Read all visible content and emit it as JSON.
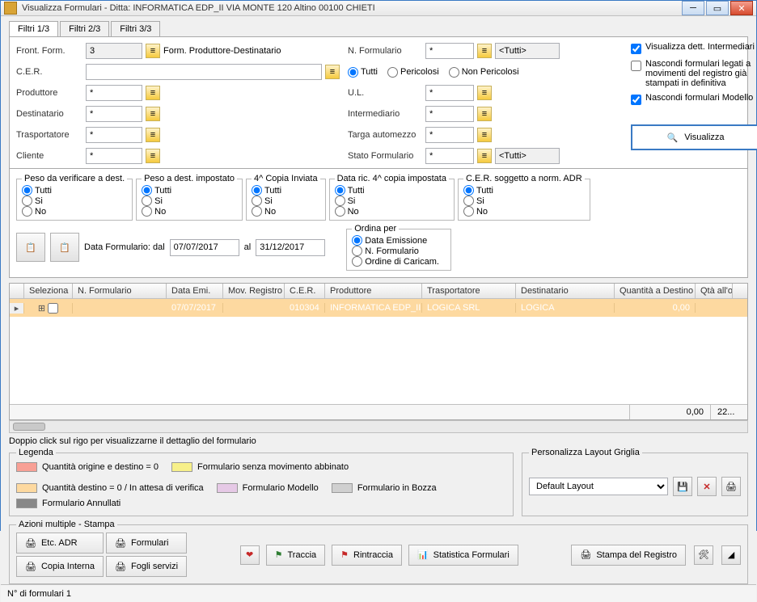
{
  "window": {
    "title": "Visualizza Formulari - Ditta: INFORMATICA EDP_II VIA MONTE 120 Altino 00100 CHIETI"
  },
  "tabs": [
    "Filtri 1/3",
    "Filtri 2/3",
    "Filtri 3/3"
  ],
  "labels": {
    "frontform": "Front. Form.",
    "cer": "C.E.R.",
    "produttore": "Produttore",
    "destinatario": "Destinatario",
    "trasportatore": "Trasportatore",
    "cliente": "Cliente",
    "frontform_val": "3",
    "frontform_desc": "Form. Produttore-Destinatario",
    "nformulario": "N. Formulario",
    "ul": "U.L.",
    "intermediario": "Intermediario",
    "targa": "Targa automezzo",
    "stato": "Stato Formulario",
    "tutti_opt": "<Tutti>",
    "star": "*",
    "tutti": "Tutti",
    "pericolosi": "Pericolosi",
    "nonpericolosi": "Non Pericolosi",
    "si": "Si",
    "no": "No"
  },
  "fieldsets": {
    "pesoverifica": "Peso da verificare a dest.",
    "pesodest": "Peso a dest. impostato",
    "copia4": "4^ Copia Inviata",
    "dataric": "Data ric. 4^ copia impostata",
    "adr": "C.E.R. soggetto a norm. ADR",
    "ordina": "Ordina per",
    "ordina_opts": [
      "Data Emissione",
      "N. Formulario",
      "Ordine di Caricam."
    ]
  },
  "dates": {
    "label": "Data Formulario: dal",
    "from": "07/07/2017",
    "to_lbl": "al",
    "to": "31/12/2017"
  },
  "side": {
    "chk1": "Visualizza dett. Intermediari",
    "chk2": "Nascondi formulari legati a movimenti del registro già stampati in definitiva",
    "chk3": "Nascondi formulari Modello",
    "visualizza": "Visualizza"
  },
  "grid": {
    "cols": [
      "",
      "Seleziona",
      "N. Formulario",
      "Data Emi.",
      "Mov. Registro",
      "C.E.R.",
      "Produttore",
      "Trasportatore",
      "Destinatario",
      "Quantità a Destino",
      "Qtà all'o"
    ],
    "row": {
      "data_emi": "07/07/2017",
      "cer": "010304",
      "produttore": "INFORMATICA EDP_II",
      "trasportatore": "LOGICA SRL",
      "destinatario": "LOGICA",
      "qta_dest": "0,00"
    },
    "footer": {
      "tot": "0,00",
      "cnt": "22..."
    }
  },
  "hint": "Doppio click sul rigo per visualizzarne il dettaglio del formulario",
  "legenda": {
    "title": "Legenda",
    "items": [
      {
        "color": "#f8a095",
        "text": "Quantità origine e destino = 0"
      },
      {
        "color": "#fdd9a0",
        "text": "Quantità destino = 0 / In attesa di verifica"
      },
      {
        "color": "#e6c9e6",
        "text": "Formulario Modello"
      },
      {
        "color": "#f7f08a",
        "text": "Formulario senza movimento abbinato"
      },
      {
        "color": "#d0d0d0",
        "text": "Formulario in Bozza"
      },
      {
        "color": "#888888",
        "text": "Formulario Annullati"
      }
    ]
  },
  "personalizza": {
    "title": "Personalizza Layout Griglia",
    "value": "Default Layout"
  },
  "actions": {
    "title": "Azioni multiple - Stampa",
    "etc_adr": "Etc. ADR",
    "formulari": "Formulari",
    "copia": "Copia Interna",
    "fogli": "Fogli servizi",
    "traccia": "Traccia",
    "rintraccia": "Rintraccia",
    "statistica": "Statistica Formulari",
    "stampa": "Stampa del Registro"
  },
  "status": "N° di formulari 1"
}
